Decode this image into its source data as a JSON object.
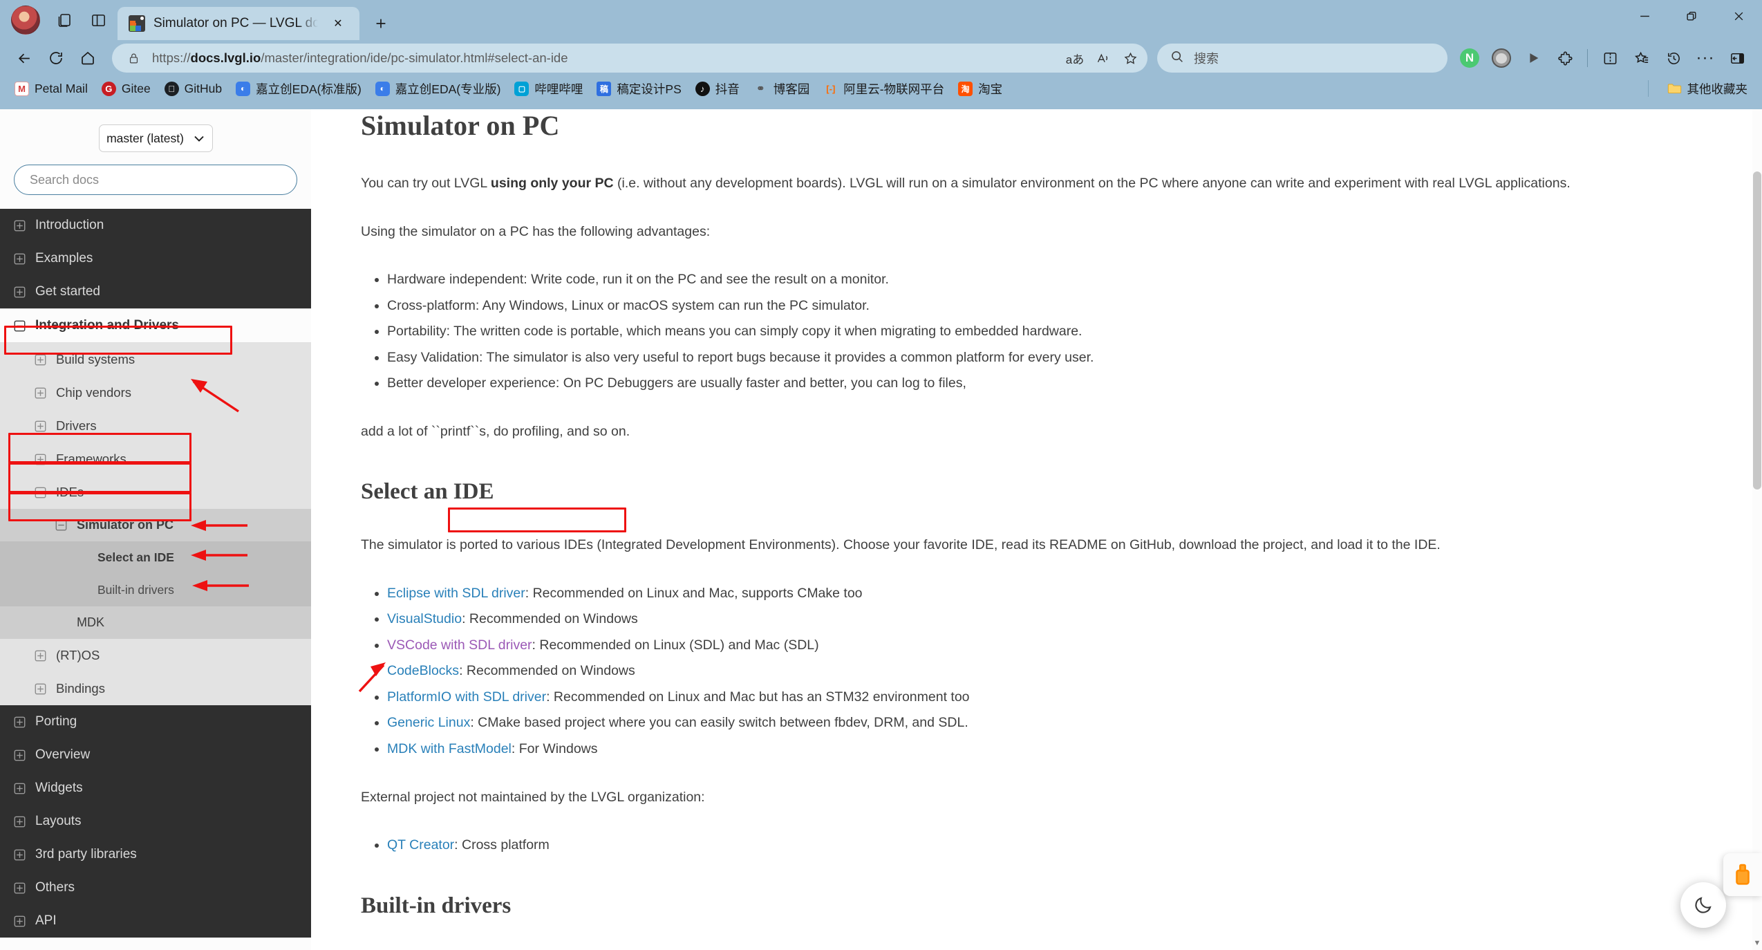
{
  "browser": {
    "tab": {
      "title": "Simulator on PC — LVGL docume",
      "favicon": "lvgl-favicon",
      "close": "✕"
    },
    "new_tab": "+",
    "window_controls": {
      "minimize": "—",
      "maximize": "❐",
      "close": "✕"
    },
    "toolbar_left": {
      "collections": "collections-icon",
      "split_screen": "split-screen-icon"
    },
    "nav": {
      "back": "back-arrow-icon",
      "refresh": "refresh-icon",
      "home": "home-icon"
    },
    "url": {
      "lock": "lock-icon",
      "prefix": "https://",
      "domain": "docs.lvgl.io",
      "path": "/master/integration/ide/pc-simulator.html#select-an-ide",
      "actions": {
        "translate": "aあ",
        "read_aloud": "read-aloud-icon",
        "favorite": "star-icon"
      }
    },
    "search": {
      "icon": "search-icon",
      "placeholder": "搜索"
    },
    "toolbar_right": [
      {
        "name": "nordvpn-extension",
        "label": "N"
      },
      {
        "name": "tampermonkey-extension",
        "label": ""
      },
      {
        "name": "play-button",
        "label": "▶"
      },
      {
        "name": "extensions-icon",
        "label": ""
      },
      {
        "name": "split-screen-icon",
        "label": ""
      },
      {
        "name": "collections-icon",
        "label": ""
      },
      {
        "name": "history-icon",
        "label": ""
      },
      {
        "name": "settings-more-icon",
        "label": "···"
      },
      {
        "name": "sidebar-toggle-icon",
        "label": ""
      }
    ],
    "bookmarks": [
      {
        "label": "Petal Mail",
        "icon": "M",
        "color": "#ffffff",
        "fg": "#d43c3c"
      },
      {
        "label": "Gitee",
        "icon": "G",
        "color": "#c71d23",
        "fg": "#ffffff"
      },
      {
        "label": "GitHub",
        "icon": "",
        "color": "#1b1f23",
        "fg": "#ffffff"
      },
      {
        "label": "嘉立创EDA(标准版)",
        "icon": "",
        "color": "#3b7de9",
        "fg": "#ffffff"
      },
      {
        "label": "嘉立创EDA(专业版)",
        "icon": "",
        "color": "#3b7de9",
        "fg": "#ffffff"
      },
      {
        "label": "哔哩哔哩",
        "icon": "",
        "color": "#00a1d6",
        "fg": "#ffffff"
      },
      {
        "label": "稿定设计PS",
        "icon": "稿",
        "color": "#2f6fe0",
        "fg": "#ffffff"
      },
      {
        "label": "抖音",
        "icon": "♪",
        "color": "#111111",
        "fg": "#ffffff"
      },
      {
        "label": "博客园",
        "icon": "",
        "color": "#fcfcfc",
        "fg": "#444444"
      },
      {
        "label": "阿里云-物联网平台",
        "icon": "[·]",
        "color": "#fcfcfc",
        "fg": "#ff6a00"
      },
      {
        "label": "淘宝",
        "icon": "淘",
        "color": "#ff5000",
        "fg": "#ffffff"
      }
    ],
    "other_bookmarks": {
      "label": "其他收藏夹",
      "icon": "folder-icon"
    }
  },
  "sidebar": {
    "version": {
      "value": "master (latest)",
      "caret": "⌄"
    },
    "search": {
      "placeholder": "Search docs"
    },
    "nav": [
      {
        "label": "Introduction",
        "level": 0,
        "toggle": "+",
        "state": "collapsed"
      },
      {
        "label": "Examples",
        "level": 0,
        "toggle": "+",
        "state": "collapsed"
      },
      {
        "label": "Get started",
        "level": 0,
        "toggle": "+",
        "state": "collapsed"
      },
      {
        "label": "Integration and Drivers",
        "level": 0,
        "toggle": "−",
        "state": "expanded-current"
      },
      {
        "label": "Build systems",
        "level": 1,
        "toggle": "+",
        "state": "collapsed"
      },
      {
        "label": "Chip vendors",
        "level": 1,
        "toggle": "+",
        "state": "collapsed"
      },
      {
        "label": "Drivers",
        "level": 1,
        "toggle": "+",
        "state": "collapsed"
      },
      {
        "label": "Frameworks",
        "level": 1,
        "toggle": "+",
        "state": "collapsed"
      },
      {
        "label": "IDEs",
        "level": 1,
        "toggle": "−",
        "state": "expanded"
      },
      {
        "label": "Simulator on PC",
        "level": 2,
        "toggle": "−",
        "state": "expanded"
      },
      {
        "label": "Select an IDE",
        "level": 3,
        "toggle": "",
        "state": "active"
      },
      {
        "label": "Built-in drivers",
        "level": 3,
        "toggle": "",
        "state": "normal"
      },
      {
        "label": "MDK",
        "level": 2,
        "toggle": "",
        "state": "normal"
      },
      {
        "label": "(RT)OS",
        "level": 1,
        "toggle": "+",
        "state": "collapsed"
      },
      {
        "label": "Bindings",
        "level": 1,
        "toggle": "+",
        "state": "collapsed"
      },
      {
        "label": "Porting",
        "level": 0,
        "toggle": "+",
        "state": "collapsed"
      },
      {
        "label": "Overview",
        "level": 0,
        "toggle": "+",
        "state": "collapsed"
      },
      {
        "label": "Widgets",
        "level": 0,
        "toggle": "+",
        "state": "collapsed"
      },
      {
        "label": "Layouts",
        "level": 0,
        "toggle": "+",
        "state": "collapsed"
      },
      {
        "label": "3rd party libraries",
        "level": 0,
        "toggle": "+",
        "state": "collapsed"
      },
      {
        "label": "Others",
        "level": 0,
        "toggle": "+",
        "state": "collapsed"
      },
      {
        "label": "API",
        "level": 0,
        "toggle": "+",
        "state": "collapsed"
      }
    ]
  },
  "doc": {
    "title": "Simulator on PC",
    "intro_a": "You can try out LVGL ",
    "intro_bold": "using only your PC",
    "intro_b": " (i.e. without any development boards). LVGL will run on a simulator environment on the PC where anyone can write and experiment with real LVGL applications.",
    "advantages_lead": "Using the simulator on a PC has the following advantages:",
    "advantages": [
      "Hardware independent: Write code, run it on the PC and see the result on a monitor.",
      "Cross-platform: Any Windows, Linux or macOS system can run the PC simulator.",
      "Portability: The written code is portable, which means you can simply copy it when migrating to embedded hardware.",
      "Easy Validation: The simulator is also very useful to report bugs because it provides a common platform for every user.",
      "Better developer experience: On PC Debuggers are usually faster and better, you can log to files,"
    ],
    "printf_note": "add a lot of ``printf``s, do profiling, and so on.",
    "select_ide_title": "Select an IDE",
    "select_ide_lead": "The simulator is ported to various IDEs (Integrated Development Environments). Choose your favorite IDE, read its README on GitHub, download the project, and load it to the IDE.",
    "ides": [
      {
        "link": "Eclipse with SDL driver",
        "rest": ": Recommended on Linux and Mac, supports CMake too",
        "visited": false
      },
      {
        "link": "VisualStudio",
        "rest": ": Recommended on Windows",
        "visited": false
      },
      {
        "link": "VSCode with SDL driver",
        "rest": ": Recommended on Linux (SDL) and Mac (SDL)",
        "visited": true
      },
      {
        "link": "CodeBlocks",
        "rest": ": Recommended on Windows",
        "visited": false
      },
      {
        "link": "PlatformIO with SDL driver",
        "rest": ": Recommended on Linux and Mac but has an STM32 environment too",
        "visited": false
      },
      {
        "link": "Generic Linux",
        "rest": ": CMake based project where you can easily switch between fbdev, DRM, and SDL.",
        "visited": false
      },
      {
        "link": "MDK with FastModel",
        "rest": ": For Windows",
        "visited": false
      }
    ],
    "external_lead": "External project not maintained by the LVGL organization:",
    "external": [
      {
        "link": "QT Creator",
        "rest": ": Cross platform",
        "visited": false
      }
    ],
    "builtin_title": "Built-in drivers"
  },
  "floating": {
    "dark_mode": "moon-icon",
    "usb_widget": "usb-device-icon"
  },
  "colors": {
    "chrome": "#9cbdd4",
    "tab_active": "#bfd7e6",
    "sidebar_dark": "#2f2f2f",
    "sidebar_l1": "#e3e3e3",
    "sidebar_l2": "#cdcdcd",
    "sidebar_l3": "#bfbfbf",
    "link": "#2980b9",
    "link_visited": "#9b59b6",
    "annotation": "#ee1111"
  }
}
